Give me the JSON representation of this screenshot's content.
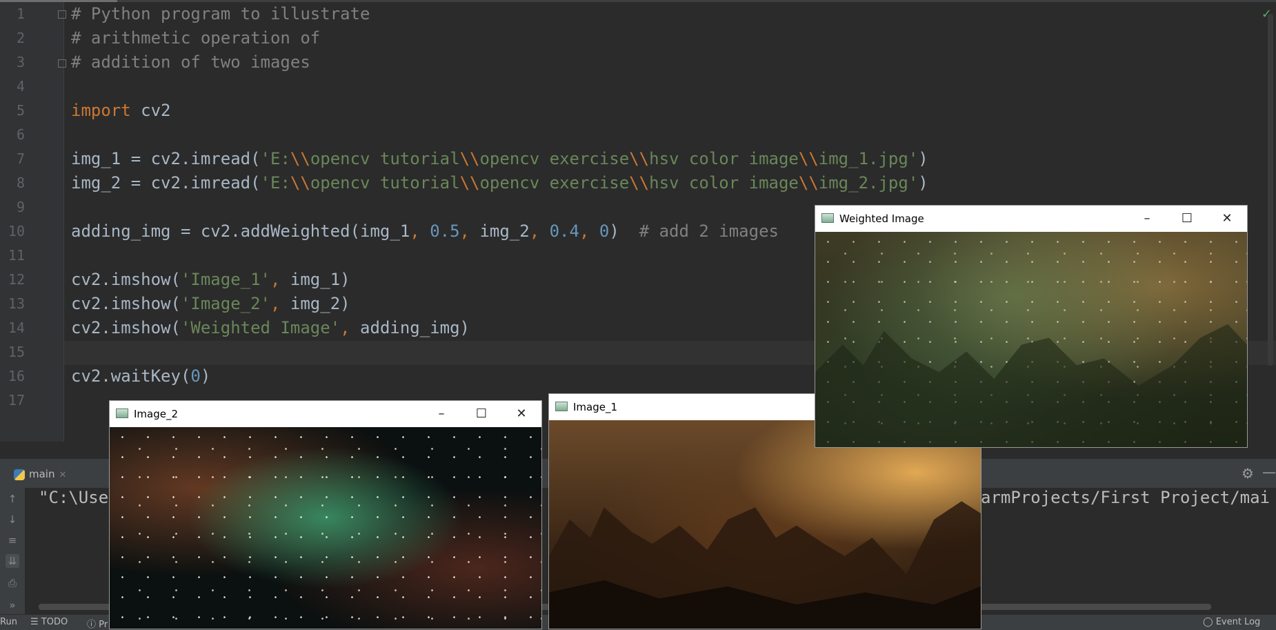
{
  "editor": {
    "line_numbers": [
      "1",
      "2",
      "3",
      "4",
      "5",
      "6",
      "7",
      "8",
      "9",
      "10",
      "11",
      "12",
      "13",
      "14",
      "15",
      "16",
      "17"
    ],
    "lines": {
      "l1": "# Python program to illustrate",
      "l2": "# arithmetic operation of",
      "l3": "# addition of two images",
      "l5_kw": "import",
      "l5_rest": " cv2",
      "l7_a": "img_1 = cv2.imread(",
      "l7_s1": "'E:",
      "l7_e1": "\\\\",
      "l7_s2": "opencv tutorial",
      "l7_e2": "\\\\",
      "l7_s3": "opencv exercise",
      "l7_e3": "\\\\",
      "l7_s4": "hsv color image",
      "l7_e4": "\\\\",
      "l7_s5": "img_1.jpg'",
      "l7_b": ")",
      "l8_a": "img_2 = cv2.imread(",
      "l8_s1": "'E:",
      "l8_e1": "\\\\",
      "l8_s2": "opencv tutorial",
      "l8_e2": "\\\\",
      "l8_s3": "opencv exercise",
      "l8_e3": "\\\\",
      "l8_s4": "hsv color image",
      "l8_e4": "\\\\",
      "l8_s5": "img_2.jpg'",
      "l8_b": ")",
      "l10_a": "adding_img = cv2.addWeighted(img_1",
      "l10_c1": ", ",
      "l10_n1": "0.5",
      "l10_c2": ", ",
      "l10_b": "img_2",
      "l10_c3": ", ",
      "l10_n2": "0.4",
      "l10_c4": ", ",
      "l10_n3": "0",
      "l10_d": ")  ",
      "l10_cmt": "# add 2 images",
      "l12_a": "cv2.imshow(",
      "l12_s": "'Image_1'",
      "l12_c": ", ",
      "l12_b": "img_1)",
      "l13_a": "cv2.imshow(",
      "l13_s": "'Image_2'",
      "l13_c": ", ",
      "l13_b": "img_2)",
      "l14_a": "cv2.imshow(",
      "l14_s": "'Weighted Image'",
      "l14_c": ", ",
      "l14_b": "adding_img)",
      "l16_a": "cv2.waitKey(",
      "l16_n": "0",
      "l16_b": ")"
    }
  },
  "run_panel": {
    "tab_label": "main",
    "output_left": "\"C:\\Use",
    "output_right": "armProjects/First Project/mai"
  },
  "status_bar": {
    "run": "Run",
    "todo": "TODO",
    "problems": "Pr",
    "event_log": "Event Log"
  },
  "windows": {
    "weighted": {
      "title": "Weighted Image"
    },
    "image2": {
      "title": "Image_2"
    },
    "image1": {
      "title": "Image_1"
    }
  },
  "colors": {
    "editor_bg": "#2b2b2b",
    "comment": "#808080",
    "keyword": "#cc7832",
    "string": "#6a8759",
    "number": "#6897bb",
    "default_text": "#a9b7c6"
  }
}
